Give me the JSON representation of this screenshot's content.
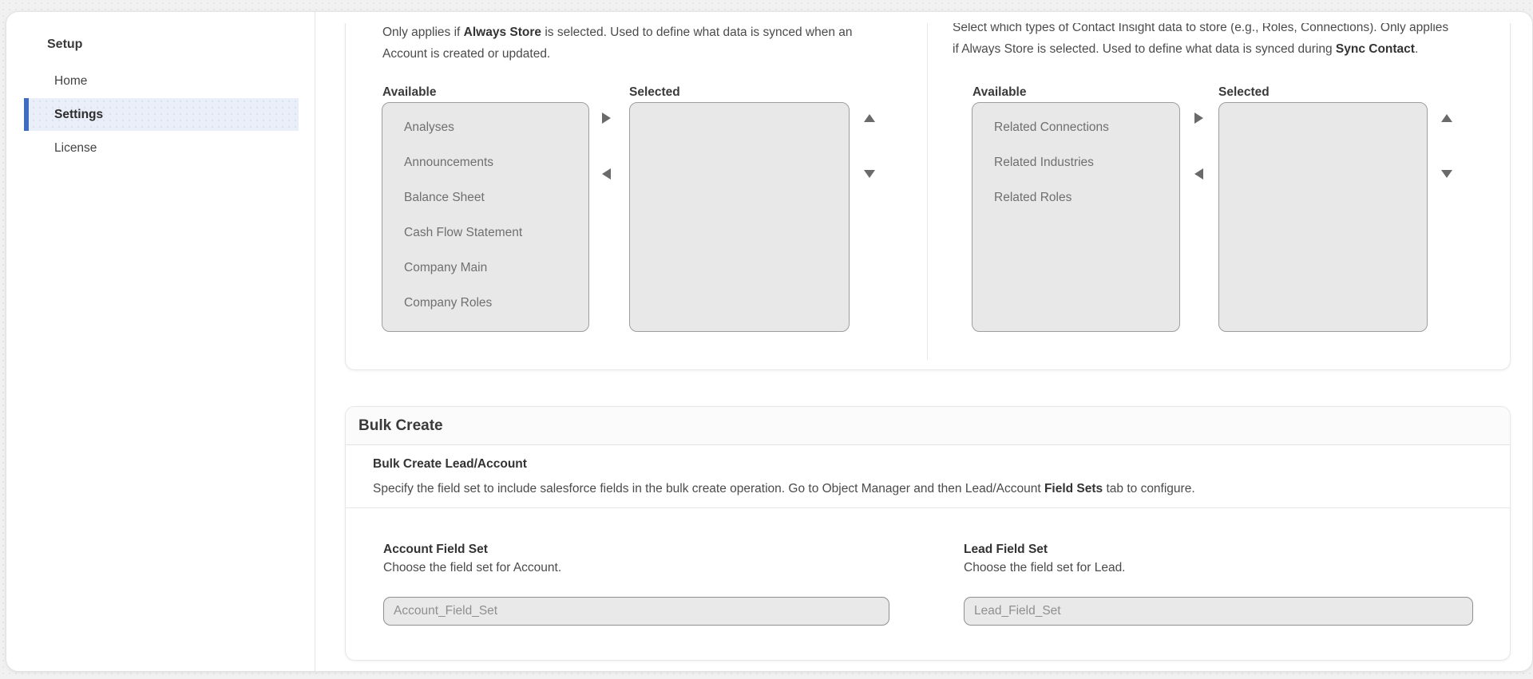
{
  "sidebar": {
    "heading": "Setup",
    "items": [
      {
        "label": "Home",
        "active": false
      },
      {
        "label": "Settings",
        "active": true
      },
      {
        "label": "License",
        "active": false
      }
    ]
  },
  "sync_store_panel": {
    "left_section": {
      "description_lines": [
        [
          {
            "t": "Only applies if "
          },
          {
            "t": "Always Store",
            "b": true
          },
          {
            "t": " is selected. Used to define what data is synced when an"
          }
        ],
        [
          {
            "t": "Account is created or updated."
          }
        ]
      ],
      "available_label": "Available",
      "selected_label": "Selected",
      "available_items": [
        "Analyses",
        "Announcements",
        "Balance Sheet",
        "Cash Flow Statement",
        "Company Main",
        "Company Roles"
      ],
      "selected_items": []
    },
    "right_section": {
      "description_lines": [
        [
          {
            "t": "Select which types of Contact Insight data to store (e.g., Roles, Connections). Only applies"
          }
        ],
        [
          {
            "t": "if Always Store is selected. Used to define what data is synced during "
          },
          {
            "t": "Sync Contact",
            "b": true
          },
          {
            "t": "."
          }
        ]
      ],
      "available_label": "Available",
      "selected_label": "Selected",
      "available_items": [
        "Related Connections",
        "Related Industries",
        "Related Roles"
      ],
      "selected_items": []
    }
  },
  "bulk_create": {
    "title": "Bulk Create",
    "subtitle": "Bulk Create Lead/Account",
    "description_lines": [
      [
        {
          "t": "Specify the field set to include salesforce fields in the bulk create operation. Go to Object Manager and then Lead/Account "
        },
        {
          "t": "Field Sets",
          "b": true
        },
        {
          "t": " tab to configure."
        }
      ]
    ],
    "fields": [
      {
        "label": "Account Field Set",
        "help": "Choose the field set for Account.",
        "placeholder": "Account_Field_Set",
        "value": ""
      },
      {
        "label": "Lead Field Set",
        "help": "Choose the field set for Lead.",
        "placeholder": "Lead_Field_Set",
        "value": ""
      }
    ]
  },
  "icons": {
    "move_right": "triangle-right",
    "move_left": "triangle-left",
    "move_up": "triangle-up",
    "move_down": "triangle-down"
  },
  "colors": {
    "accent_blue": "#3e6cc2",
    "active_item_bg": "#e9eef8",
    "page_bg": "#f1f1f2",
    "listbox_bg": "#e8e8e8",
    "listbox_border": "#9e9e9e",
    "input_bg": "#e9e9e9",
    "input_border": "#8f8f8f",
    "arrow_gray": "#6a6a6a"
  }
}
